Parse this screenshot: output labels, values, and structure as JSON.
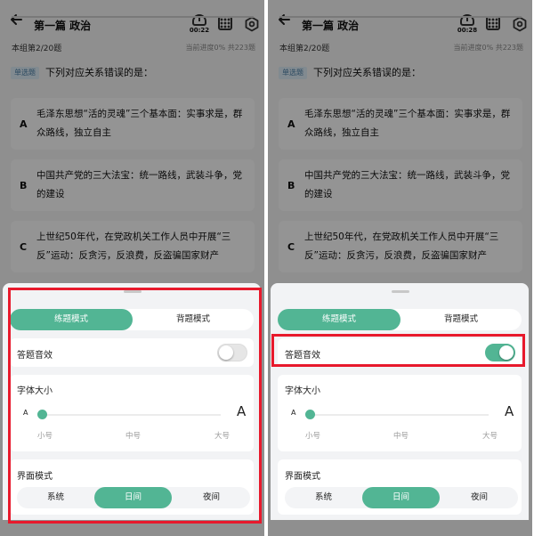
{
  "panels": [
    {
      "header": {
        "title": "第一篇 政治",
        "timer": "00:22"
      },
      "progress": {
        "group_label": "本组第2/20题",
        "summary": "当前进度0%  共223题",
        "fraction": 0.0
      },
      "question": {
        "type_badge": "单选题",
        "text": "下列对应关系错误的是："
      },
      "options": [
        {
          "letter": "A",
          "text": "毛泽东思想“活的灵魂”三个基本面：实事求是，群众路线，独立自主"
        },
        {
          "letter": "B",
          "text": "中国共产党的三大法宝：统一路线，武装斗争，党的建设"
        },
        {
          "letter": "C",
          "text": "上世纪50年代，在党政机关工作人员中开展“三反”运动：反贪污，反浪费，反盗骗国家财产"
        }
      ],
      "settings": {
        "mode_tabs": {
          "practice": "练题模式",
          "recite": "背题模式",
          "selected": "practice"
        },
        "sound": {
          "label": "答题音效",
          "enabled": false
        },
        "font_size": {
          "title": "字体大小",
          "small_glyph": "A",
          "large_glyph": "A",
          "levels": [
            "小号",
            "中号",
            "大号"
          ],
          "selected": "小号"
        },
        "theme": {
          "title": "界面模式",
          "options": [
            "系统",
            "日间",
            "夜间"
          ],
          "selected": "日间"
        }
      }
    },
    {
      "header": {
        "title": "第一篇 政治",
        "timer": "00:28"
      },
      "progress": {
        "group_label": "本组第2/20题",
        "summary": "当前进度0%  共223题",
        "fraction": 0.0
      },
      "question": {
        "type_badge": "单选题",
        "text": "下列对应关系错误的是："
      },
      "options": [
        {
          "letter": "A",
          "text": "毛泽东思想“活的灵魂”三个基本面：实事求是，群众路线，独立自主"
        },
        {
          "letter": "B",
          "text": "中国共产党的三大法宝：统一路线，武装斗争，党的建设"
        },
        {
          "letter": "C",
          "text": "上世纪50年代，在党政机关工作人员中开展“三反”运动：反贪污，反浪费，反盗骗国家财产"
        }
      ],
      "settings": {
        "mode_tabs": {
          "practice": "练题模式",
          "recite": "背题模式",
          "selected": "practice"
        },
        "sound": {
          "label": "答题音效",
          "enabled": true
        },
        "font_size": {
          "title": "字体大小",
          "small_glyph": "A",
          "large_glyph": "A",
          "levels": [
            "小号",
            "中号",
            "大号"
          ],
          "selected": "小号"
        },
        "theme": {
          "title": "界面模式",
          "options": [
            "系统",
            "日间",
            "夜间"
          ],
          "selected": "日间"
        }
      }
    }
  ],
  "colors": {
    "accent": "#52b594",
    "highlight": "#e8192c",
    "badge_bg": "#dfeef8"
  }
}
